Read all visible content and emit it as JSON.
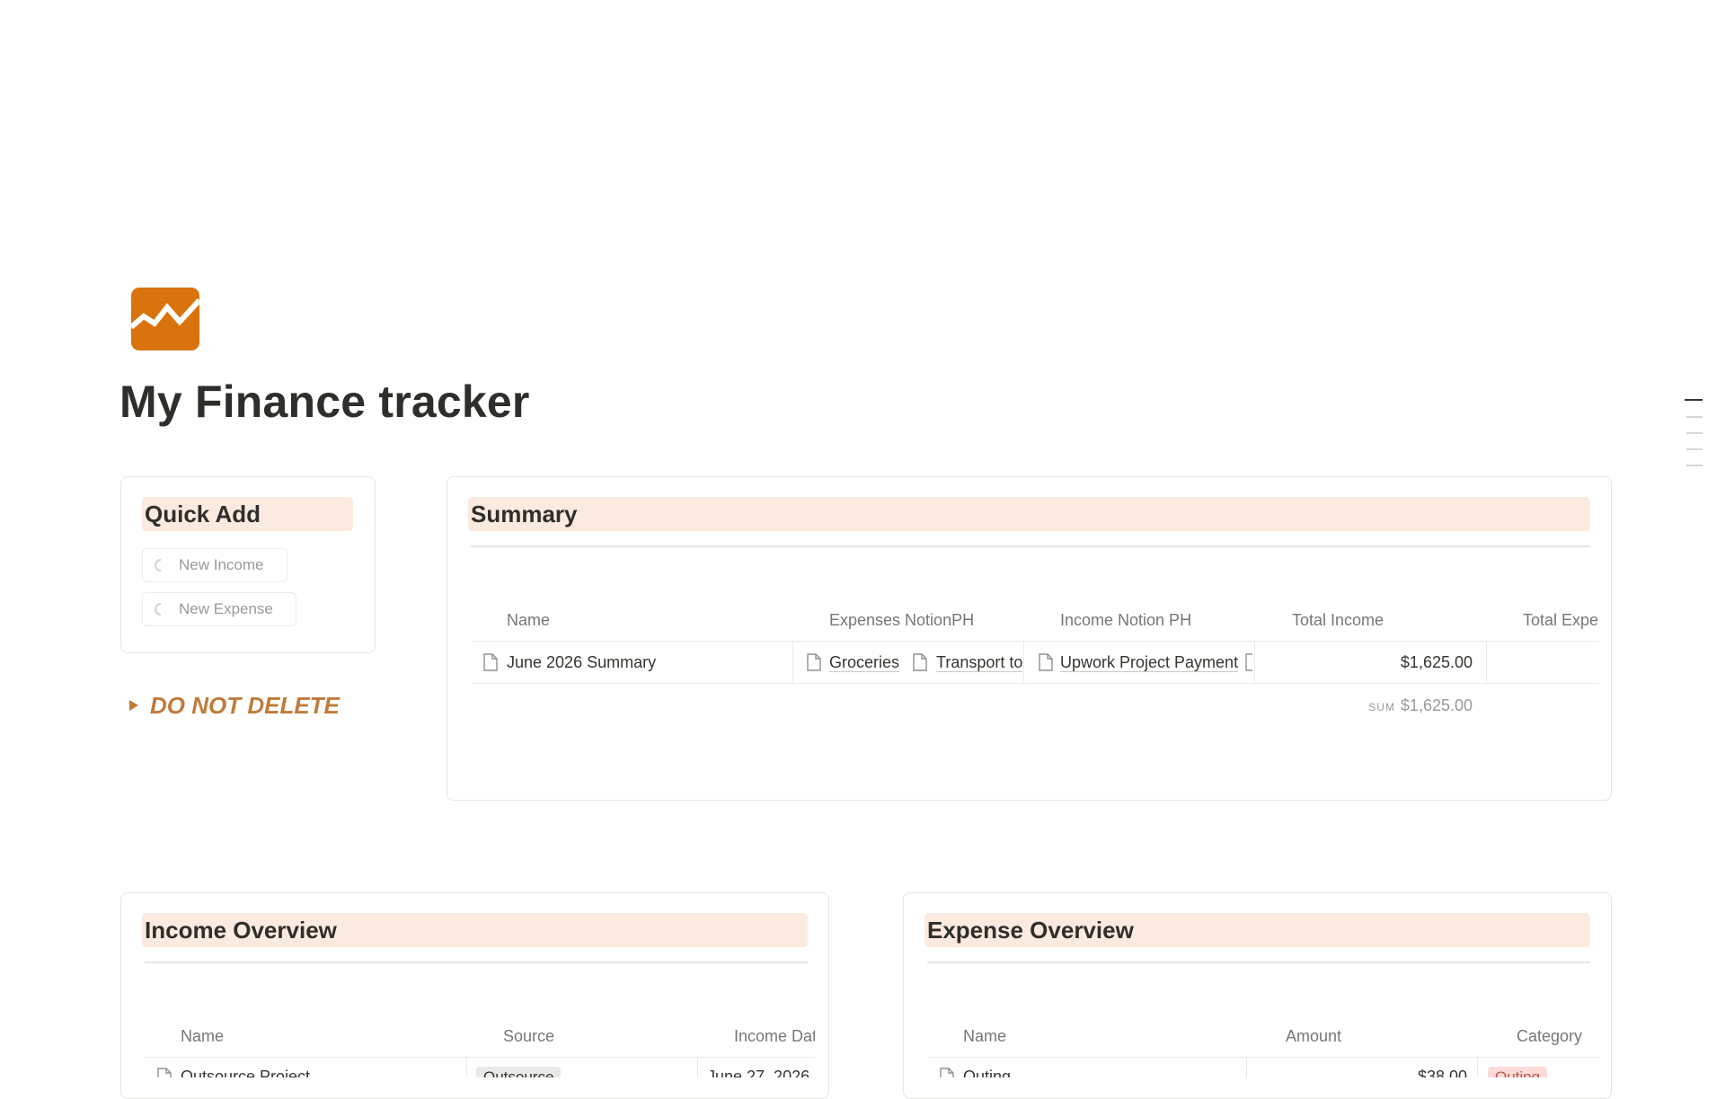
{
  "page": {
    "title": "My Finance tracker",
    "icon": "trending-chart-icon",
    "accent": "#d9730d"
  },
  "quick_add": {
    "title": "Quick Add",
    "buttons": [
      {
        "label": "New Income"
      },
      {
        "label": "New Expense"
      }
    ]
  },
  "toggle": {
    "label": "DO NOT DELETE",
    "color": "#c07a3a"
  },
  "summary": {
    "title": "Summary",
    "columns": [
      "Name",
      "Expenses NotionPH",
      "Income Notion PH",
      "Total Income",
      "Total Expe"
    ],
    "rows": [
      {
        "name": "June 2026 Summary",
        "expenses": [
          "Groceries",
          "Transport to"
        ],
        "income": [
          "Upwork Project Payment"
        ],
        "total_income": "$1,625.00"
      }
    ],
    "footer": {
      "label": "SUM",
      "value": "$1,625.00"
    }
  },
  "income_overview": {
    "title": "Income Overview",
    "columns": [
      "Name",
      "Source",
      "Income Dat"
    ],
    "rows": [
      {
        "name": "Outsource Project",
        "source": "Outsource",
        "date": "June 27, 2026"
      }
    ]
  },
  "expense_overview": {
    "title": "Expense Overview",
    "columns": [
      "Name",
      "Amount",
      "Category"
    ],
    "rows": [
      {
        "name": "Outing",
        "amount": "$38.00",
        "category": "Outing"
      }
    ]
  },
  "colors": {
    "title_bg": "#fbeae0",
    "source_tag_bg": "#e9e9e7",
    "category_tag_bg": "#fadbd8",
    "category_tag_text": "#c4554d"
  }
}
